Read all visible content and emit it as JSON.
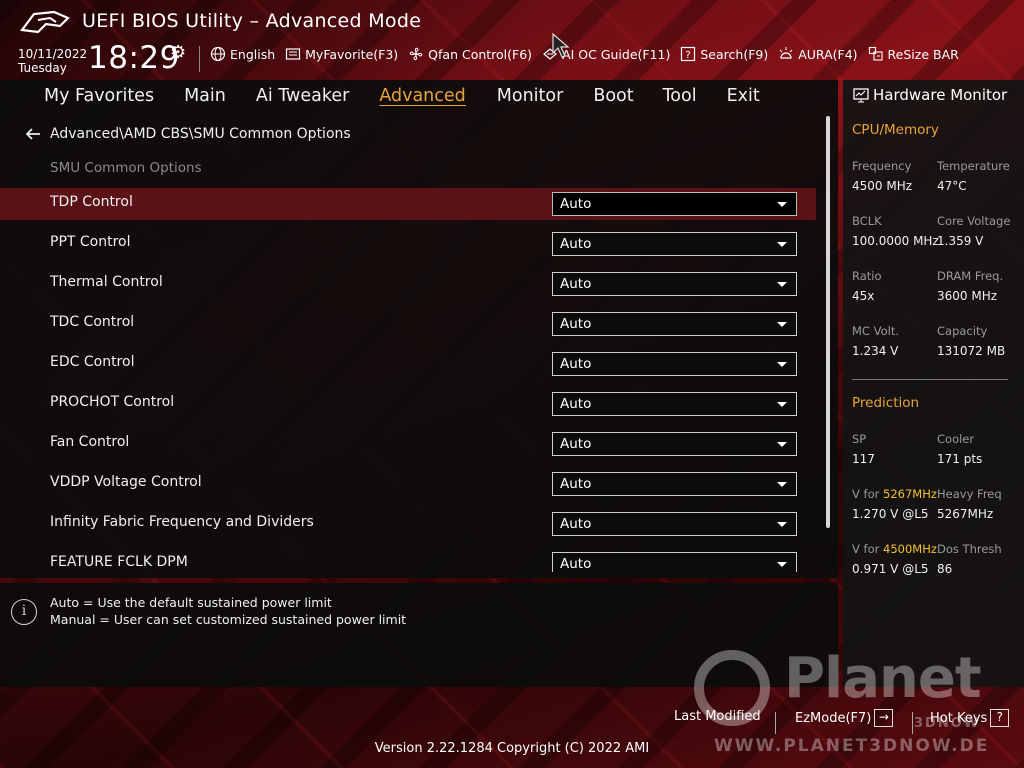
{
  "header": {
    "title": "UEFI BIOS Utility – Advanced Mode",
    "date": "10/11/2022",
    "day": "Tuesday",
    "time": "18:29",
    "toolbar": [
      {
        "label": "English",
        "icon": "globe-icon"
      },
      {
        "label": "MyFavorite(F3)",
        "icon": "favorite-icon"
      },
      {
        "label": "Qfan Control(F6)",
        "icon": "fan-icon"
      },
      {
        "label": "AI OC Guide(F11)",
        "icon": "ai-chip-icon"
      },
      {
        "label": "Search(F9)",
        "icon": "search-icon"
      },
      {
        "label": "AURA(F4)",
        "icon": "aura-icon"
      },
      {
        "label": "ReSize BAR",
        "icon": "resize-bar-icon"
      }
    ]
  },
  "nav": {
    "tabs": [
      {
        "label": "My Favorites"
      },
      {
        "label": "Main"
      },
      {
        "label": "Ai Tweaker"
      },
      {
        "label": "Advanced",
        "active": true
      },
      {
        "label": "Monitor"
      },
      {
        "label": "Boot"
      },
      {
        "label": "Tool"
      },
      {
        "label": "Exit"
      }
    ]
  },
  "page": {
    "breadcrumb": "Advanced\\AMD CBS\\SMU Common Options",
    "section_label": "SMU Common Options",
    "options": [
      {
        "label": "TDP Control",
        "value": "Auto",
        "selected": true
      },
      {
        "label": "PPT Control",
        "value": "Auto"
      },
      {
        "label": "Thermal Control",
        "value": "Auto"
      },
      {
        "label": "TDC Control",
        "value": "Auto"
      },
      {
        "label": "EDC Control",
        "value": "Auto"
      },
      {
        "label": "PROCHOT Control",
        "value": "Auto"
      },
      {
        "label": "Fan Control",
        "value": "Auto"
      },
      {
        "label": "VDDP Voltage Control",
        "value": "Auto"
      },
      {
        "label": "Infinity Fabric Frequency and Dividers",
        "value": "Auto"
      },
      {
        "label": "FEATURE FCLK DPM",
        "value": "Auto"
      }
    ]
  },
  "help": {
    "lines": [
      "Auto = Use the default sustained power limit",
      "Manual = User can set customized sustained power limit"
    ]
  },
  "hw_monitor": {
    "title": "Hardware Monitor",
    "cpu_section": "CPU/Memory",
    "cpu": {
      "freq_label": "Frequency",
      "freq_value": "4500 MHz",
      "temp_label": "Temperature",
      "temp_value": "47°C",
      "bclk_label": "BCLK",
      "bclk_value": "100.0000 MHz",
      "cv_label": "Core Voltage",
      "cv_value": "1.359 V",
      "ratio_label": "Ratio",
      "ratio_value": "45x",
      "dram_label": "DRAM Freq.",
      "dram_value": "3600 MHz",
      "mcv_label": "MC Volt.",
      "mcv_value": "1.234 V",
      "cap_label": "Capacity",
      "cap_value": "131072 MB"
    },
    "pred_section": "Prediction",
    "prediction": {
      "sp_label": "SP",
      "sp_value": "117",
      "cooler_label": "Cooler",
      "cooler_value": "171 pts",
      "vfor1_prefix": "V for ",
      "vfor1_freq": "5267MHz",
      "vfor1_value": "1.270 V @L5",
      "heavy_label": "Heavy Freq",
      "heavy_value": "5267MHz",
      "vfor2_prefix": "V for ",
      "vfor2_freq": "4500MHz",
      "vfor2_value": "0.971 V @L5",
      "dos_label": "Dos Thresh",
      "dos_value": "86"
    }
  },
  "footer": {
    "last_modified": "Last Modified",
    "ezmode": "EzMode(F7)",
    "hotkeys": "Hot Keys",
    "hotkeys_icon": "?",
    "version": "Version 2.22.1284 Copyright (C) 2022 AMI"
  },
  "watermark": {
    "name": "Planet",
    "tagline": "3DNOW",
    "url": "WWW.PLANET3DNOW.DE"
  },
  "colors": {
    "accent": "#e8a33a",
    "highlight": "#f0c030",
    "selected_row": "#5a1216",
    "panel_bg": "#0c0c0c"
  }
}
